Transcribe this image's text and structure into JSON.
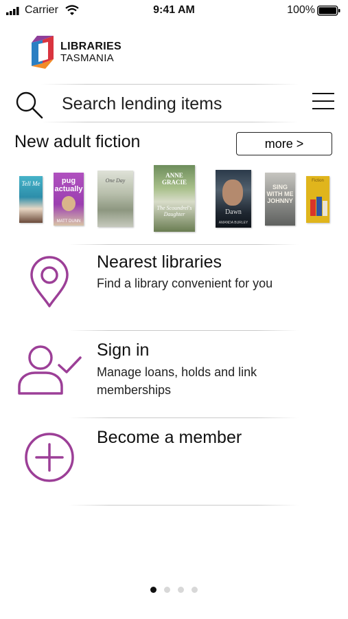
{
  "status_bar": {
    "carrier": "Carrier",
    "time": "9:41 AM",
    "battery": "100%"
  },
  "logo": {
    "line1": "LIBRARIES",
    "line2": "TASMANIA"
  },
  "search": {
    "placeholder": "Search lending items"
  },
  "new_fiction": {
    "title": "New adult fiction",
    "more_label": "more >",
    "books": [
      {
        "title": "Tell Me"
      },
      {
        "title": "pug actually",
        "author": "MATT DUNN"
      },
      {
        "title": "One Day"
      },
      {
        "title": "The Scoundrel's Daughter",
        "author": "ANNE GRACIE"
      },
      {
        "title": "Dawn",
        "author": "AMANDA BURLEY"
      },
      {
        "title": "SING WITH ME JOHNNY"
      },
      {
        "title": "Fiction"
      }
    ]
  },
  "menu_items": [
    {
      "title": "Nearest libraries",
      "subtitle": "Find a library convenient for you"
    },
    {
      "title": "Sign in",
      "subtitle": "Manage loans, holds and link memberships"
    },
    {
      "title": "Become a member",
      "subtitle": ""
    }
  ],
  "pager": {
    "pages": 4,
    "current": 1
  },
  "colors": {
    "accent": "#9c3f97",
    "text": "#111111",
    "divider": "#c9c9c9"
  }
}
